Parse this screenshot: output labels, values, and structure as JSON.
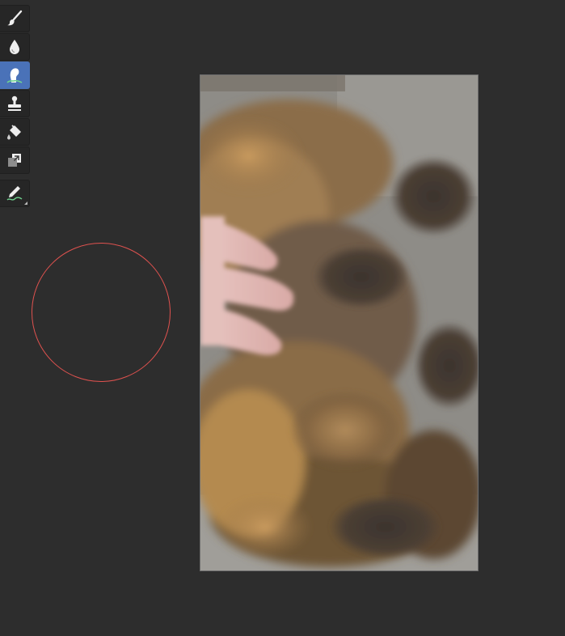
{
  "app": {
    "background_color": "#2d2d2d",
    "accent_color": "#4a72b8",
    "brush_cursor_color": "#e0524f"
  },
  "toolbar": {
    "tools": [
      {
        "icon": "paintbrush-icon",
        "active": false
      },
      {
        "icon": "water-drop-icon",
        "active": false
      },
      {
        "icon": "smudge-finger-icon",
        "active": true
      },
      {
        "icon": "clone-stamp-icon",
        "active": false
      },
      {
        "icon": "paint-bucket-icon",
        "active": false
      },
      {
        "icon": "layer-copy-icon",
        "active": false
      },
      {
        "icon": "pen-stroke-icon",
        "active": false
      }
    ]
  },
  "canvas": {
    "image": "photo-of-tortoiseshell-cat-being-petted"
  }
}
